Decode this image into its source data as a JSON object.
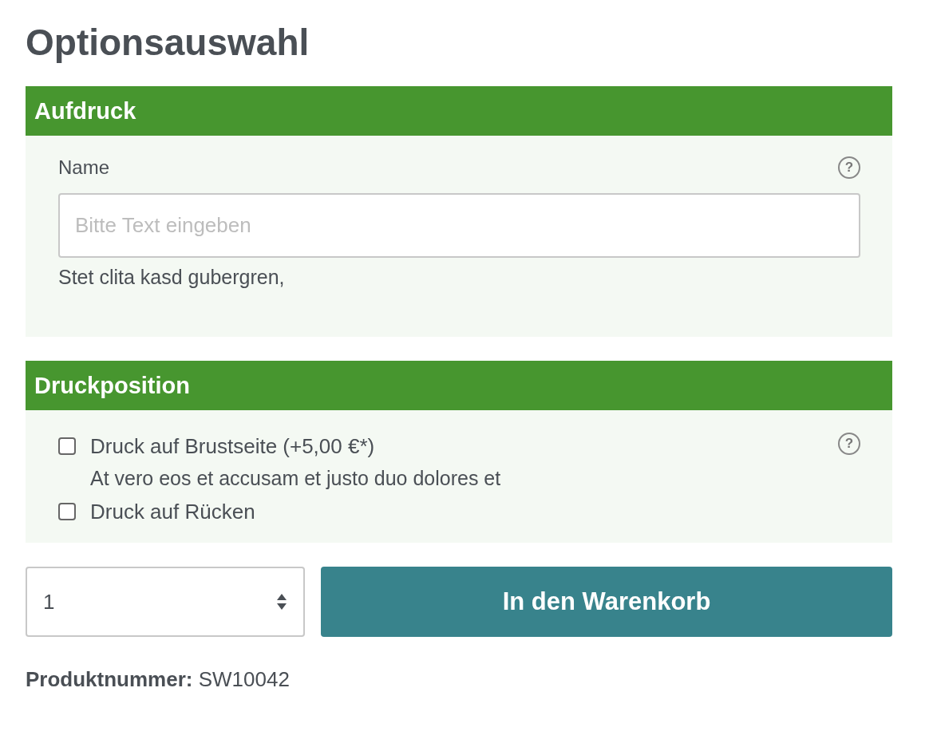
{
  "page_title": "Optionsauswahl",
  "sections": [
    {
      "title": "Aufdruck",
      "fields": [
        {
          "kind": "text",
          "label": "Name",
          "help": "?",
          "placeholder": "Bitte Text eingeben",
          "description": "Stet clita kasd gubergren,"
        }
      ]
    },
    {
      "title": "Druckposition",
      "fields": [
        {
          "kind": "checkboxes",
          "help": "?",
          "options": [
            {
              "label": "Druck auf Brustseite (+5,00 €*)",
              "checked": false,
              "description": "At vero eos et accusam et justo duo dolores et"
            },
            {
              "label": "Druck auf Rücken",
              "checked": false
            }
          ]
        }
      ]
    }
  ],
  "quantity": {
    "value": "1"
  },
  "add_to_cart": "In den Warenkorb",
  "product_number": {
    "label": "Produktnummer:",
    "value": "SW10042"
  }
}
